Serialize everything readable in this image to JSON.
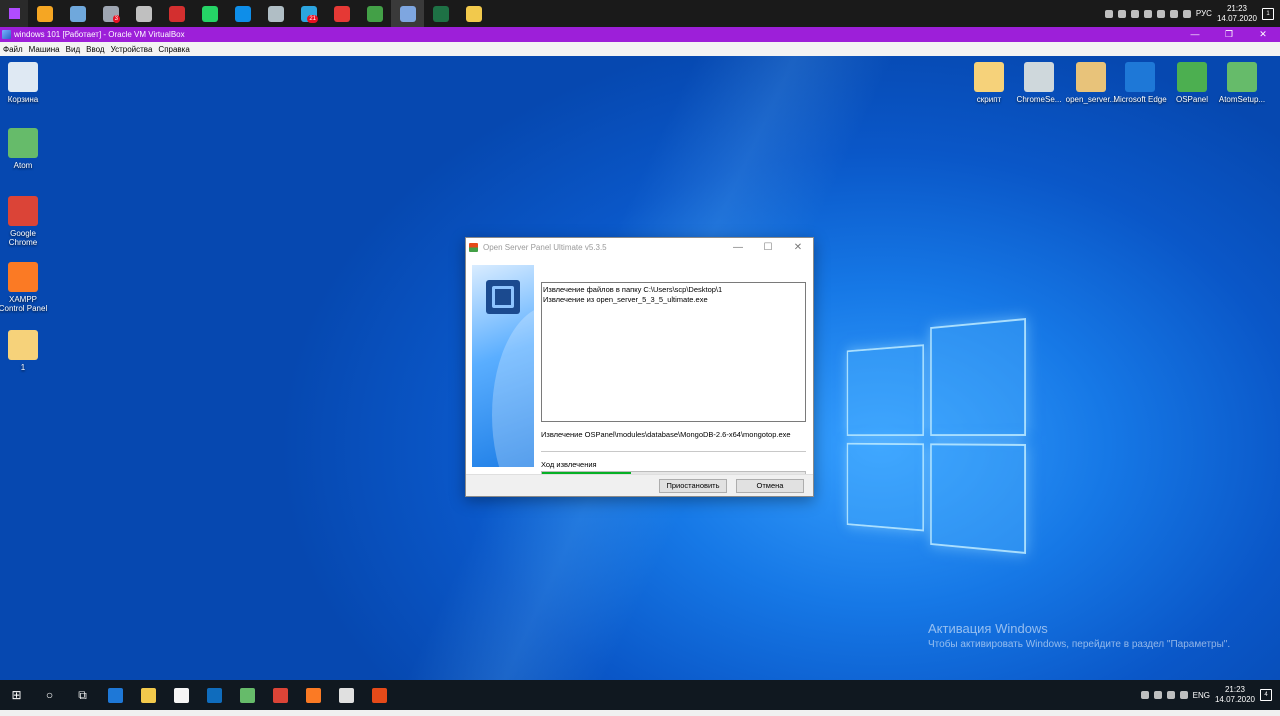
{
  "host_taskbar": {
    "apps": [
      {
        "icon": "fire-app-icon",
        "color": "#f5a623"
      },
      {
        "icon": "virtualbox-icon",
        "color": "#6fa8dc"
      },
      {
        "icon": "terminal-icon",
        "color": "#9fa6b2",
        "badge": "3"
      },
      {
        "icon": "network-icon",
        "color": "#c0c0c0"
      },
      {
        "icon": "filezilla-icon",
        "color": "#d32f2f"
      },
      {
        "icon": "whatsapp-icon",
        "color": "#25d366"
      },
      {
        "icon": "teamviewer-icon",
        "color": "#0e8ee9"
      },
      {
        "icon": "notepad-icon",
        "color": "#b0bec5"
      },
      {
        "icon": "telegram-icon",
        "color": "#2ca5e0",
        "badge": "21"
      },
      {
        "icon": "yandex-icon",
        "color": "#e53935"
      },
      {
        "icon": "green-app-icon",
        "color": "#43a047"
      },
      {
        "icon": "virtualbox-active-icon",
        "color": "#7ea6e0"
      },
      {
        "icon": "excel-icon",
        "color": "#1e7145"
      },
      {
        "icon": "explorer-icon",
        "color": "#f2c94c"
      }
    ],
    "lang": "РУС",
    "time": "21:23",
    "date": "14.07.2020",
    "notifications": "1"
  },
  "vbox": {
    "title": "windows 101 [Работает] - Oracle VM VirtualBox",
    "menu": [
      "Файл",
      "Машина",
      "Вид",
      "Ввод",
      "Устройства",
      "Справка"
    ],
    "controls": [
      "—",
      "❐",
      "✕"
    ]
  },
  "desktop_icons_left": [
    {
      "label": "Корзина",
      "icon": "recycle-bin-icon",
      "color": "#dfe9f3"
    },
    {
      "label": "Atom",
      "icon": "atom-icon",
      "color": "#66bb6a"
    },
    {
      "label": "Google Chrome",
      "icon": "chrome-icon",
      "color": "#db4437"
    },
    {
      "label": "XAMPP Control Panel",
      "icon": "xampp-icon",
      "color": "#fb7a24"
    },
    {
      "label": "1",
      "icon": "folder-icon",
      "color": "#f6d27a"
    }
  ],
  "desktop_icons_right": [
    {
      "label": "скрипт",
      "icon": "folder-icon",
      "color": "#f6d27a"
    },
    {
      "label": "ChromeSe...",
      "icon": "disc-setup-icon",
      "color": "#cfd8dc"
    },
    {
      "label": "open_server...",
      "icon": "archive-icon",
      "color": "#e8c37a"
    },
    {
      "label": "Microsoft Edge",
      "icon": "edge-icon",
      "color": "#1e78d7"
    },
    {
      "label": "OSPanel",
      "icon": "ospanel-icon",
      "color": "#4caf50"
    },
    {
      "label": "AtomSetup...",
      "icon": "atom-icon",
      "color": "#66bb6a"
    }
  ],
  "dialog": {
    "title": "Open Server Panel Ultimate v5.3.5",
    "controls": [
      "—",
      "☐",
      "✕"
    ],
    "log": [
      "Извлечение файлов в папку C:\\Users\\scp\\Desktop\\1",
      "Извлечение из open_server_5_3_5_ultimate.exe"
    ],
    "current_file": "Извлечение OSPanel\\modules\\database\\MongoDB-2.6-x64\\mongotop.exe",
    "progress_label": "Ход извлечения",
    "progress_percent": 34,
    "pause_button": "Приостановить",
    "cancel_button": "Отмена"
  },
  "activation": {
    "title": "Активация Windows",
    "subtitle": "Чтобы активировать Windows, перейдите в раздел \"Параметры\"."
  },
  "guest_taskbar": {
    "start_glyph": "⊞",
    "search_glyph": "○",
    "taskview_glyph": "⧉",
    "apps": [
      {
        "icon": "edge-icon",
        "color": "#1e78d7"
      },
      {
        "icon": "file-explorer-icon",
        "color": "#f2c94c"
      },
      {
        "icon": "store-icon",
        "color": "#f5f5f5"
      },
      {
        "icon": "mail-icon",
        "color": "#0f6cbd"
      },
      {
        "icon": "atom-icon",
        "color": "#66bb6a"
      },
      {
        "icon": "chrome-icon",
        "color": "#db4437"
      },
      {
        "icon": "xampp-icon",
        "color": "#fb7a24"
      },
      {
        "icon": "settings-icon",
        "color": "#e0e0e0"
      },
      {
        "icon": "ospanel-tray-icon",
        "color": "#e64a19"
      }
    ],
    "lang": "ENG",
    "time": "21:23",
    "date": "14.07.2020",
    "notifications": "4"
  }
}
